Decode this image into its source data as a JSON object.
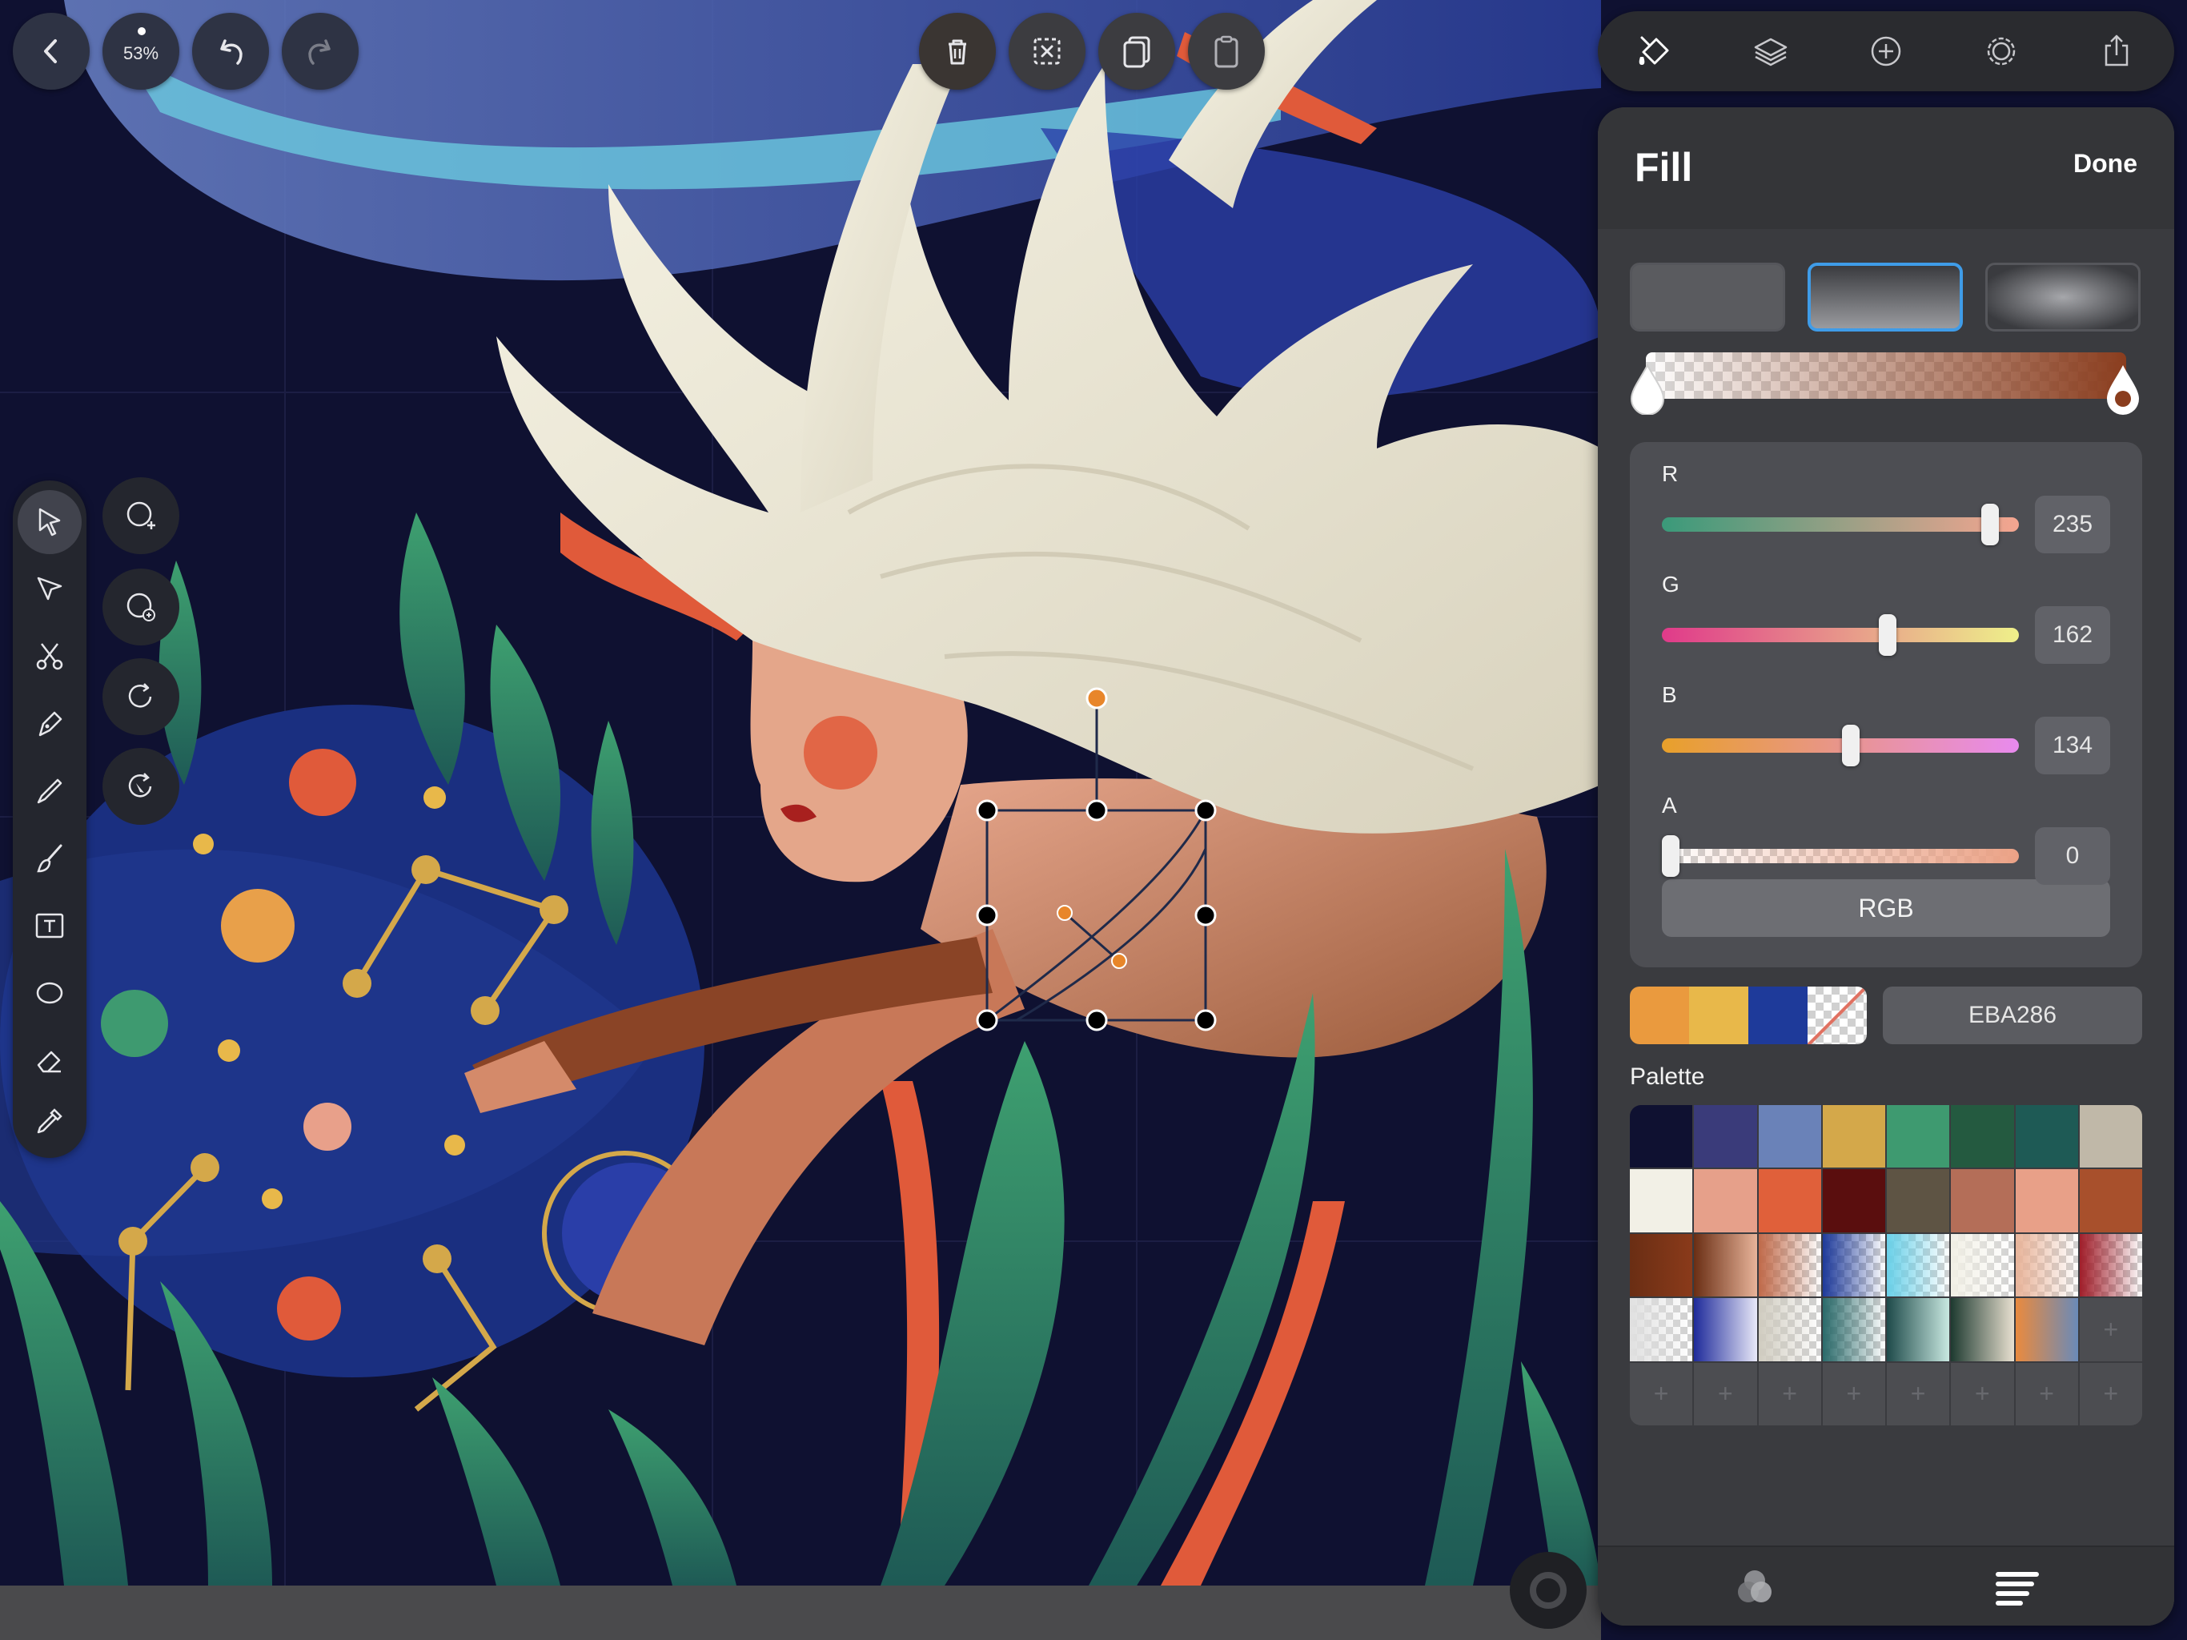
{
  "hud": {
    "zoom_label": "53%"
  },
  "icons": {
    "back": "chevron-left-icon",
    "undo": "undo-icon",
    "redo": "redo-icon",
    "delete": "trash-icon",
    "deselect": "deselect-icon",
    "duplicate": "duplicate-icon",
    "paste": "paste-icon"
  },
  "left_toolbar": {
    "tools": [
      "selection-arrow",
      "node-select",
      "scissors",
      "pen",
      "pencil",
      "brush",
      "text",
      "ellipse",
      "eraser",
      "eyedropper"
    ],
    "active_tool": "selection-arrow",
    "sub_tools": [
      "add-selection",
      "add-point",
      "rotate",
      "reset-rotate"
    ]
  },
  "panel_topbar": {
    "icons": [
      "fill-bucket-icon",
      "layers-icon",
      "add-icon",
      "settings-icon",
      "share-icon"
    ],
    "active": "fill-bucket-icon"
  },
  "fill_panel": {
    "title": "Fill",
    "done_label": "Done",
    "fill_types": [
      "flat",
      "linear-gradient",
      "radial-gradient"
    ],
    "selected_fill_type": "linear-gradient",
    "gradient": {
      "start_color": "#ffffff",
      "end_color": "#8a3d1e"
    },
    "channels": [
      {
        "label": "R",
        "value": "235",
        "fraction": 0.94,
        "from": "#3a9a7a",
        "to": "#f5a590"
      },
      {
        "label": "G",
        "value": "162",
        "fraction": 0.64,
        "from": "#e03a8a",
        "to": "#eef08a"
      },
      {
        "label": "B",
        "value": "134",
        "fraction": 0.53,
        "from": "#e8a02a",
        "to": "#e88aee"
      },
      {
        "label": "A",
        "value": "0",
        "fraction": 0.0,
        "from": "#d9d9d9",
        "to": "#eba286"
      }
    ],
    "mode_label": "RGB",
    "recent_colors": [
      "#ea9a3e",
      "#e8b84a",
      "#1e3a9a",
      "transparent"
    ],
    "hex_value": "EBA286",
    "palette_label": "Palette",
    "palette": [
      "#0f1131",
      "#3a3b7a",
      "#6a82b8",
      "#d4a84a",
      "#3e9a70",
      "#245a40",
      "#1e5a55",
      "#c0b8a8",
      "#f2f0e6",
      "#e6a08a",
      "#e0603a",
      "#5a0e0e",
      "#5e5444",
      "#b46e58",
      "#e8a088",
      "#a8502c",
      "g:#6a2e14,#8a3a1a",
      "g:#6a2e14,#e8b49a",
      "g:#c06a4a,checker",
      "g:#1e3a9a,checker",
      "g:#6ad0e8,checker",
      "g:#f2f0e6,checker",
      "g:#e8b49a,checker",
      "g:#a01e2a,checker",
      "g:#e0e0e0,checker",
      "g:#1e2a9a,#e8e8f8",
      "g:#d0ccc0,checker",
      "g:#2a6a6a,checker",
      "g:#1e4a4a,#c8e8e0",
      "g:#1e3a30,#e8e0d0",
      "g:#ea8a3e,#6a8ab8",
      "empty",
      "empty",
      "empty",
      "empty",
      "empty",
      "empty",
      "empty",
      "empty",
      "empty"
    ]
  },
  "panel_footer": {
    "icons": [
      "color-mix-icon",
      "align-icon"
    ]
  }
}
